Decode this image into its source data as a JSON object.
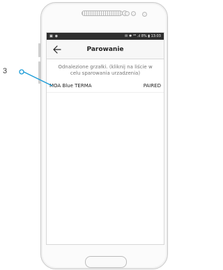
{
  "callout": {
    "number": "3",
    "color": "#1a9bd7"
  },
  "status_bar": {
    "left_icons": [
      "message-icon",
      "alarm-icon"
    ],
    "right_text": "✉ ✱ ⁴ᴳ .ıl 8% ▮ 13:03"
  },
  "header": {
    "title": "Parowanie",
    "back_icon": "arrow-left-icon"
  },
  "content": {
    "hint": "Odnalezione grzałki. (kliknij na liście w celu sparowania urzadzenia)",
    "devices": [
      {
        "name": "MOA Blue TERMA",
        "status": "PAIRED"
      }
    ]
  }
}
